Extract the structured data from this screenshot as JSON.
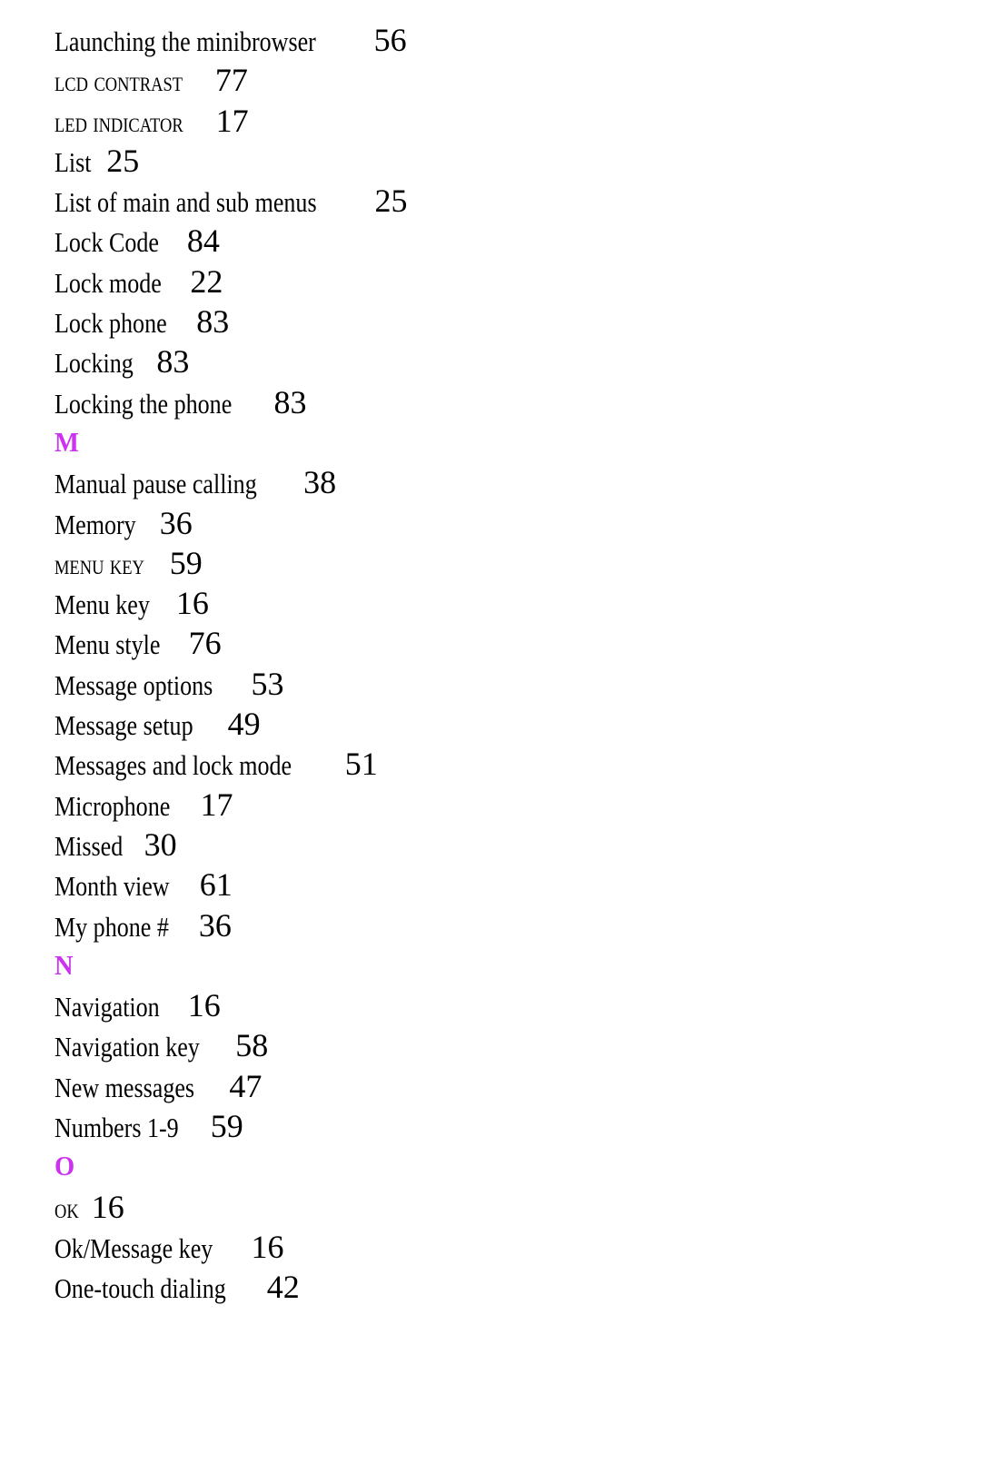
{
  "page": {
    "type": "index",
    "background_color": "#ffffff",
    "text_color": "#000000",
    "heading_color": "#cc33ee"
  },
  "blocks": [
    {
      "kind": "entry",
      "label": "Launching the minibrowser",
      "page": "56",
      "smallcaps": false
    },
    {
      "kind": "entry",
      "label": "LCD Contrast",
      "page": "77",
      "smallcaps": true
    },
    {
      "kind": "entry",
      "label": "LED indicator",
      "page": "17",
      "smallcaps": true
    },
    {
      "kind": "entry",
      "label": "List",
      "page": "25",
      "smallcaps": false
    },
    {
      "kind": "entry",
      "label": "List of main and sub menus",
      "page": "25",
      "smallcaps": false
    },
    {
      "kind": "entry",
      "label": "Lock Code",
      "page": "84",
      "smallcaps": false
    },
    {
      "kind": "entry",
      "label": "Lock mode",
      "page": "22",
      "smallcaps": false
    },
    {
      "kind": "entry",
      "label": "Lock phone",
      "page": "83",
      "smallcaps": false
    },
    {
      "kind": "entry",
      "label": "Locking",
      "page": "83",
      "smallcaps": false
    },
    {
      "kind": "entry",
      "label": "Locking the phone",
      "page": "83",
      "smallcaps": false
    },
    {
      "kind": "heading",
      "letter": "M"
    },
    {
      "kind": "entry",
      "label": "Manual pause calling",
      "page": "38",
      "smallcaps": false
    },
    {
      "kind": "entry",
      "label": "Memory",
      "page": "36",
      "smallcaps": false
    },
    {
      "kind": "entry",
      "label": "MENU key",
      "page": "59",
      "smallcaps": true
    },
    {
      "kind": "entry",
      "label": "Menu key",
      "page": "16",
      "smallcaps": false
    },
    {
      "kind": "entry",
      "label": "Menu style",
      "page": "76",
      "smallcaps": false
    },
    {
      "kind": "entry",
      "label": "Message options",
      "page": "53",
      "smallcaps": false
    },
    {
      "kind": "entry",
      "label": "Message setup",
      "page": "49",
      "smallcaps": false
    },
    {
      "kind": "entry",
      "label": "Messages and lock mode",
      "page": "51",
      "smallcaps": false
    },
    {
      "kind": "entry",
      "label": "Microphone",
      "page": "17",
      "smallcaps": false
    },
    {
      "kind": "entry",
      "label": "Missed",
      "page": "30",
      "smallcaps": false
    },
    {
      "kind": "entry",
      "label": "Month view",
      "page": "61",
      "smallcaps": false
    },
    {
      "kind": "entry",
      "label": "My phone #",
      "page": "36",
      "smallcaps": false
    },
    {
      "kind": "heading",
      "letter": "N"
    },
    {
      "kind": "entry",
      "label": "Navigation",
      "page": "16",
      "smallcaps": false
    },
    {
      "kind": "entry",
      "label": "Navigation key",
      "page": "58",
      "smallcaps": false
    },
    {
      "kind": "entry",
      "label": "New messages",
      "page": "47",
      "smallcaps": false
    },
    {
      "kind": "entry",
      "label": "Numbers 1-9",
      "page": "59",
      "smallcaps": false
    },
    {
      "kind": "heading",
      "letter": "O"
    },
    {
      "kind": "entry",
      "label": "OK",
      "page": "16",
      "smallcaps": true
    },
    {
      "kind": "entry",
      "label": "Ok/Message key",
      "page": "16",
      "smallcaps": false
    },
    {
      "kind": "entry",
      "label": "One-touch dialing",
      "page": "42",
      "smallcaps": false
    }
  ]
}
